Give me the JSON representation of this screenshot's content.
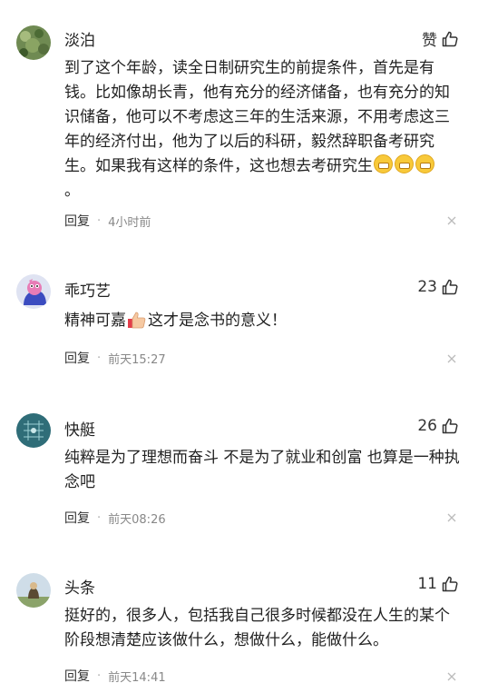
{
  "comments": [
    {
      "name": "淡泊",
      "like_label": "赞",
      "text_parts": [
        "到了这个年龄，读全日制研究生的前提条件，首先是有钱。比如像胡长青，他有充分的经济储备，也有充分的知识储备，他可以不考虑这三年的生活来源，不用考虑这三年的经济付出，他为了以后的科研，毅然辞职备考研究生。如果我有这样的条件，这也想去考研究生",
        "。"
      ],
      "reply_label": "回复",
      "time": "4小时前"
    },
    {
      "name": "乖巧艺",
      "like_count": "23",
      "text_parts": [
        "精神可嘉",
        "这才是念书的意义！"
      ],
      "reply_label": "回复",
      "time": "前天15:27"
    },
    {
      "name": "快艇",
      "like_count": "26",
      "text": "纯粹是为了理想而奋斗 不是为了就业和创富 也算是一种执念吧",
      "reply_label": "回复",
      "time": "前天08:26"
    },
    {
      "name": "头条",
      "like_count": "11",
      "text": "挺好的，很多人，包括我自己很多时候都没在人生的某个阶段想清楚应该做什么，想做什么，能做什么。",
      "reply_label": "回复",
      "time": "前天14:41"
    }
  ],
  "icons": {
    "like": "thumbs-up-icon",
    "dismiss": "close-icon",
    "grin_emoji": "grinning-emoji",
    "thumbs_emoji": "thumbs-up-emoji"
  },
  "colors": {
    "text": "#222222",
    "meta": "#888888",
    "divider": "#f0f0f0"
  }
}
